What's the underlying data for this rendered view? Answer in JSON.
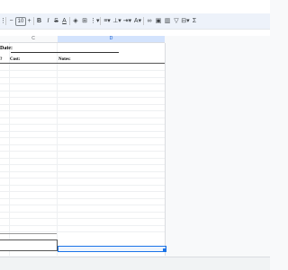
{
  "toolbar": {
    "minus_label": "−",
    "font_size": "10",
    "plus_label": "+",
    "bold_label": "B",
    "italic_label": "I",
    "strike_label": "S",
    "underline_label": "A"
  },
  "columns": {
    "c_label": "C",
    "d_label": "D"
  },
  "form": {
    "date_label": "Date:",
    "q_label": "?",
    "cost_label": "Cost:",
    "notes_label": "Notes:"
  },
  "colors": {
    "selection_blue": "#1a73e8",
    "toolbar_bg": "#edf2fa"
  }
}
